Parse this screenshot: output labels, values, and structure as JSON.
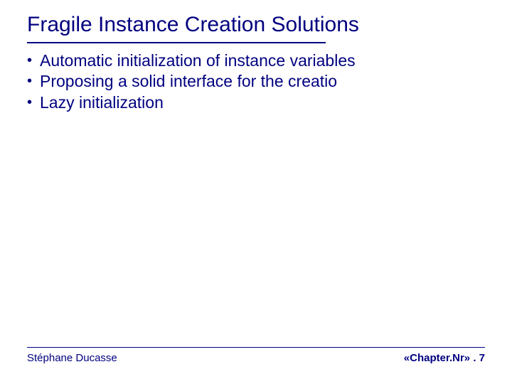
{
  "slide": {
    "title": "Fragile Instance Creation Solutions",
    "bullets": [
      "Automatic initialization of instance variables",
      "Proposing a solid interface for the creatio",
      "Lazy initialization"
    ],
    "footer": {
      "author": "Stéphane Ducasse",
      "pageRef": "«Chapter.Nr» . 7"
    }
  }
}
